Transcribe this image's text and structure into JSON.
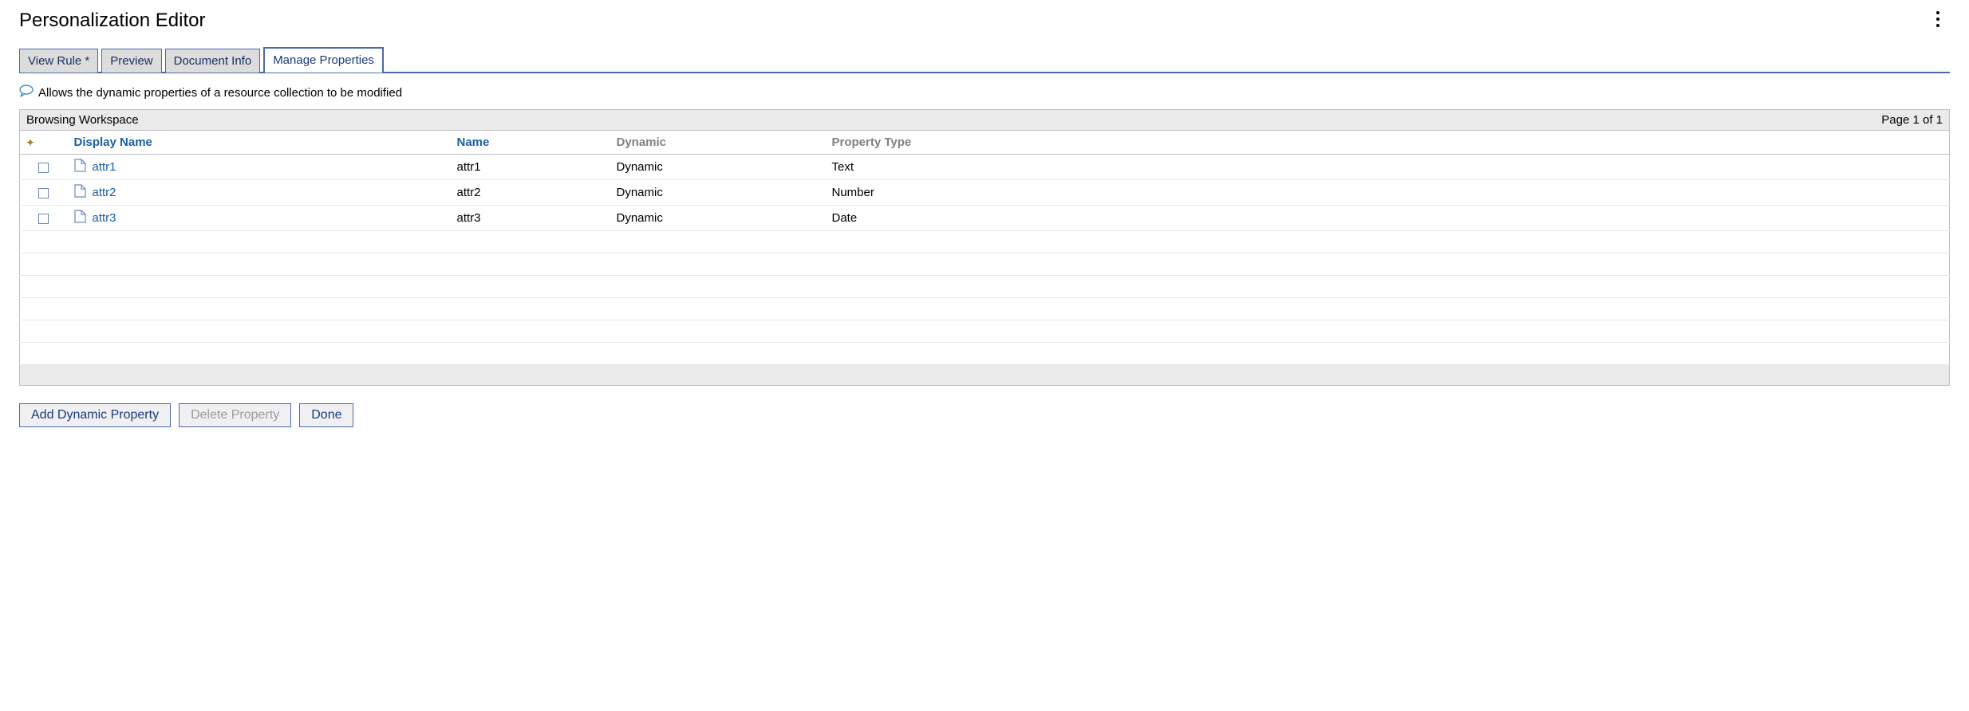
{
  "header": {
    "title": "Personalization Editor"
  },
  "tabs": [
    {
      "label": "View Rule *",
      "active": false
    },
    {
      "label": "Preview",
      "active": false
    },
    {
      "label": "Document Info",
      "active": false
    },
    {
      "label": "Manage Properties",
      "active": true
    }
  ],
  "hint": "Allows the dynamic properties of a resource collection to be modified",
  "strip": {
    "breadcrumb": "Browsing Workspace",
    "pager": "Page 1 of 1"
  },
  "table": {
    "columns": {
      "display_name": "Display Name",
      "name": "Name",
      "dynamic": "Dynamic",
      "property_type": "Property Type"
    },
    "rows": [
      {
        "display": "attr1",
        "name": "attr1",
        "dynamic": "Dynamic",
        "type": "Text"
      },
      {
        "display": "attr2",
        "name": "attr2",
        "dynamic": "Dynamic",
        "type": "Number"
      },
      {
        "display": "attr3",
        "name": "attr3",
        "dynamic": "Dynamic",
        "type": "Date"
      }
    ],
    "empty_rows": 6
  },
  "buttons": {
    "add": "Add Dynamic Property",
    "delete": "Delete Property",
    "done": "Done"
  }
}
